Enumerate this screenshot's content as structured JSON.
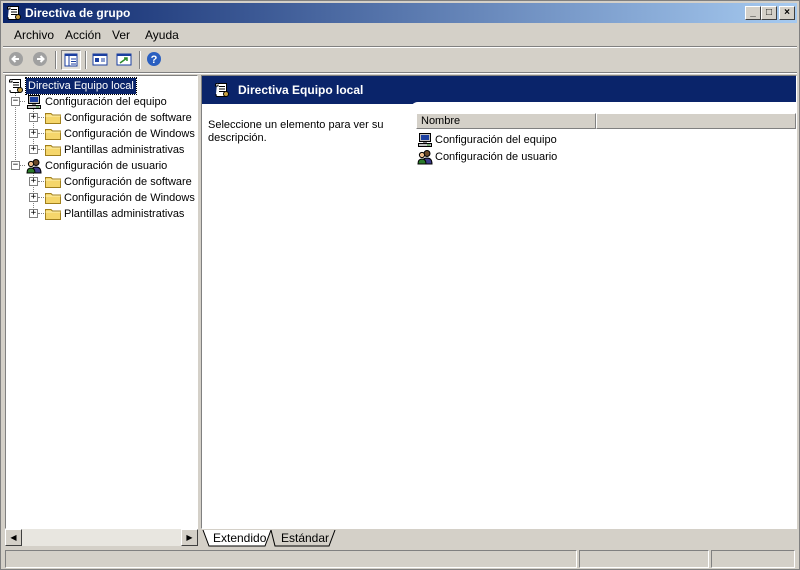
{
  "window": {
    "title": "Directiva de grupo",
    "app_icon": "policy-scroll-icon"
  },
  "title_controls": {
    "minimize": "_",
    "maximize": "□",
    "close": "×"
  },
  "menu": [
    {
      "label": "Archivo"
    },
    {
      "label": "Acción"
    },
    {
      "label": "Ver"
    },
    {
      "label": "Ayuda"
    }
  ],
  "toolbar": {
    "buttons": [
      "back-arrow-icon",
      "forward-arrow-icon",
      "show-tree-icon",
      "properties-icon",
      "export-list-icon",
      "help-icon"
    ],
    "help_glyph": "?"
  },
  "tree": {
    "root": {
      "label": "Directiva Equipo local",
      "icon": "policy-scroll-icon",
      "selected": true
    },
    "nodes": [
      {
        "label": "Configuración del equipo",
        "icon": "computer-icon",
        "expander": "−",
        "children": [
          {
            "label": "Configuración de software",
            "icon": "folder-icon",
            "expander": "+"
          },
          {
            "label": "Configuración de Windows",
            "icon": "folder-icon",
            "expander": "+"
          },
          {
            "label": "Plantillas administrativas",
            "icon": "folder-icon",
            "expander": "+"
          }
        ]
      },
      {
        "label": "Configuración de usuario",
        "icon": "users-icon",
        "expander": "−",
        "children": [
          {
            "label": "Configuración de software",
            "icon": "folder-icon",
            "expander": "+"
          },
          {
            "label": "Configuración de Windows",
            "icon": "folder-icon",
            "expander": "+"
          },
          {
            "label": "Plantillas administrativas",
            "icon": "folder-icon",
            "expander": "+"
          }
        ]
      }
    ]
  },
  "scrollbar": {
    "left_arrow": "◀",
    "right_arrow": "▶"
  },
  "details": {
    "banner_title": "Directiva Equipo local",
    "description": "Seleccione un elemento para ver su descripción.",
    "columns": [
      "Nombre",
      ""
    ],
    "items": [
      {
        "label": "Configuración del equipo",
        "icon": "computer-icon"
      },
      {
        "label": "Configuración de usuario",
        "icon": "users-icon"
      }
    ]
  },
  "tabs": [
    {
      "label": "Extendido",
      "active": true
    },
    {
      "label": "Estándar",
      "active": false
    }
  ],
  "colors": {
    "title_start": "#0a246a",
    "title_end": "#a6caf0",
    "banner": "#0a246a",
    "face": "#d4d0c8",
    "selection": "#0a246a",
    "folder": "#f5d66b"
  }
}
